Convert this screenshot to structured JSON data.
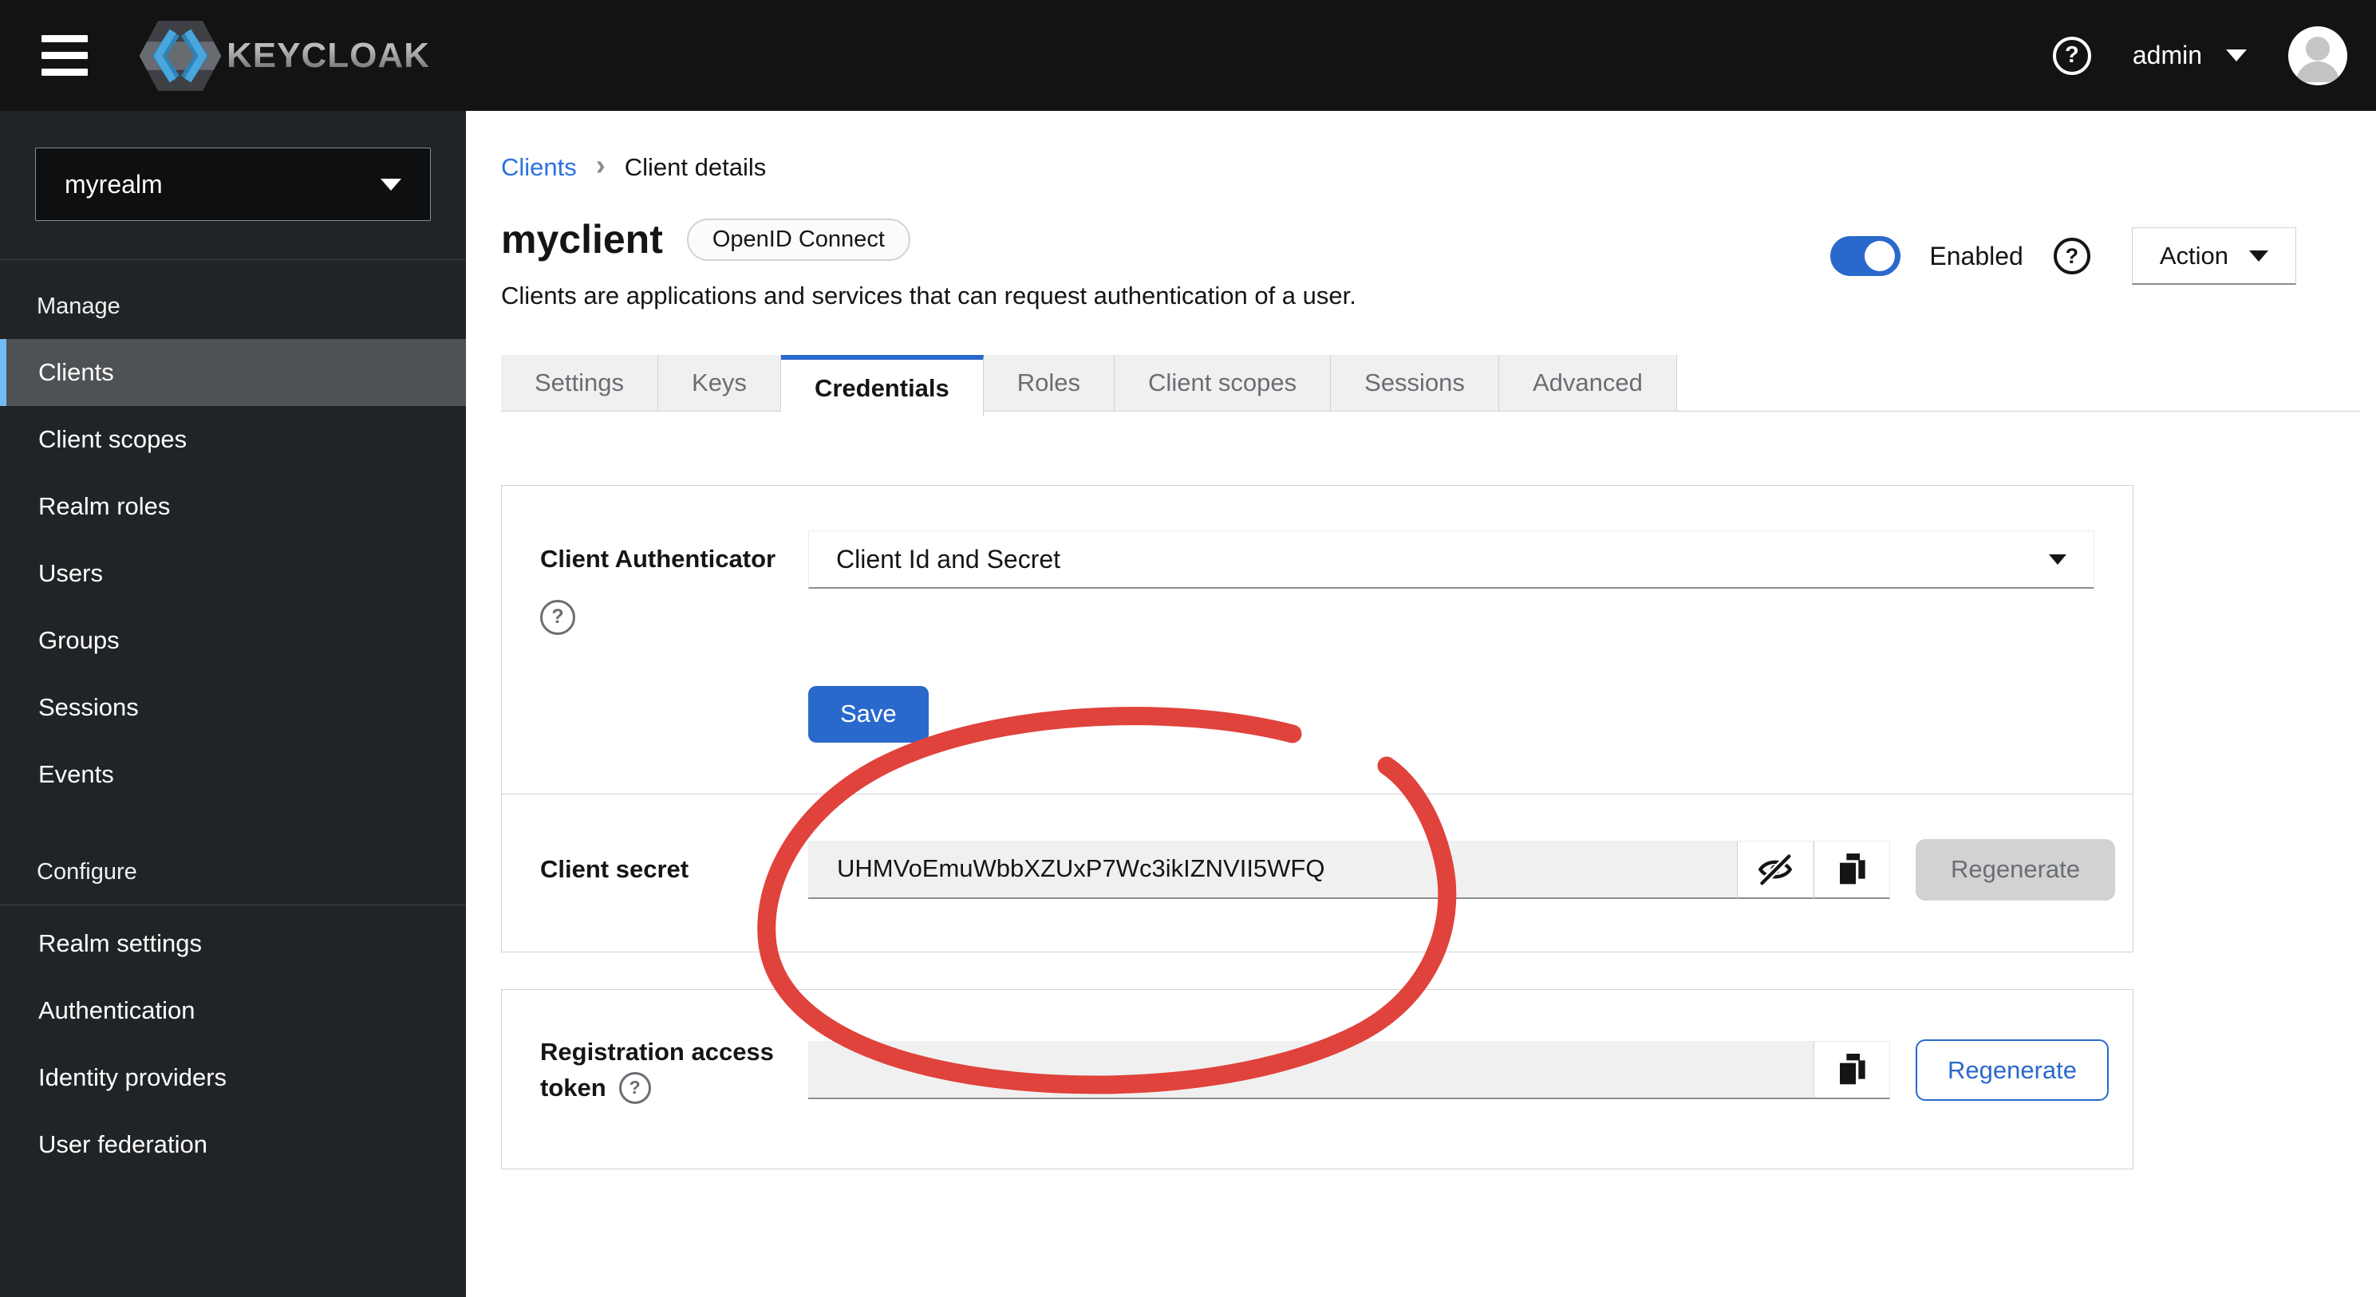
{
  "topbar": {
    "brand": "KEYCLOAK",
    "user_name": "admin"
  },
  "sidebar": {
    "realm": "myrealm",
    "manage": {
      "label": "Manage",
      "items": [
        {
          "label": "Clients",
          "active": true
        },
        {
          "label": "Client scopes"
        },
        {
          "label": "Realm roles"
        },
        {
          "label": "Users"
        },
        {
          "label": "Groups"
        },
        {
          "label": "Sessions"
        },
        {
          "label": "Events"
        }
      ]
    },
    "configure": {
      "label": "Configure",
      "items": [
        {
          "label": "Realm settings"
        },
        {
          "label": "Authentication"
        },
        {
          "label": "Identity providers"
        },
        {
          "label": "User federation"
        }
      ]
    }
  },
  "breadcrumb": {
    "parent": "Clients",
    "separator": "›",
    "current": "Client details"
  },
  "header": {
    "title": "myclient",
    "protocol_badge": "OpenID Connect",
    "description": "Clients are applications and services that can request authentication of a user.",
    "enabled_label": "Enabled",
    "action_label": "Action"
  },
  "tabs": [
    {
      "label": "Settings"
    },
    {
      "label": "Keys"
    },
    {
      "label": "Credentials",
      "active": true
    },
    {
      "label": "Roles"
    },
    {
      "label": "Client scopes"
    },
    {
      "label": "Sessions"
    },
    {
      "label": "Advanced"
    }
  ],
  "credentials": {
    "client_authenticator": {
      "label": "Client Authenticator",
      "value": "Client Id and Secret"
    },
    "save_label": "Save",
    "client_secret": {
      "label": "Client secret",
      "value": "UHMVoEmuWbbXZUxP7Wc3ikIZNVII5WFQ",
      "regenerate_label": "Regenerate"
    },
    "registration_access_token": {
      "label_line1": "Registration access",
      "label_line2": "token",
      "value": "",
      "regenerate_label": "Regenerate"
    }
  },
  "icons": {
    "help_glyph": "?"
  },
  "colors": {
    "primary_blue": "#2a69cc",
    "annotation_red": "#e0423c",
    "nav_active_indicator": "#73bcf7",
    "topbar_bg": "#131313",
    "sidebar_bg": "#212427"
  }
}
